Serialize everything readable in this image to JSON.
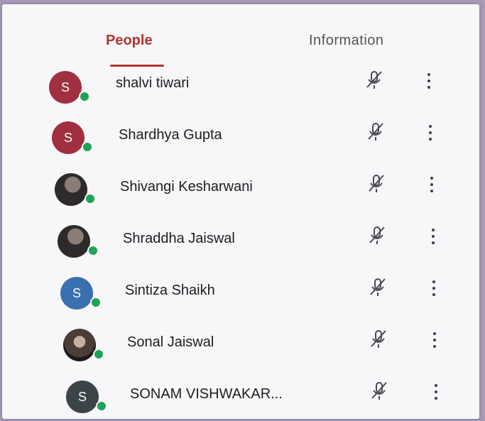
{
  "tabs": {
    "people": "People",
    "information": "Information"
  },
  "colors": {
    "accent": "#b3332f",
    "online": "#1fa357"
  },
  "icons": {
    "mic": "mic-off-icon",
    "more": "more-vert-icon"
  },
  "participants": [
    {
      "name": "shalvi tiwari",
      "initial": "S",
      "avatar_color": "#a0303f",
      "online": true,
      "muted": true
    },
    {
      "name": "Shardhya Gupta",
      "initial": "S",
      "avatar_color": "#a0303f",
      "online": true,
      "muted": true
    },
    {
      "name": "Shivangi Kesharwani",
      "initial": "",
      "avatar_color": "#2e2a2a",
      "online": true,
      "muted": true
    },
    {
      "name": "Shraddha Jaiswal",
      "initial": "",
      "avatar_color": "#2e2a2a",
      "online": true,
      "muted": true
    },
    {
      "name": "Sintiza Shaikh",
      "initial": "S",
      "avatar_color": "#3a6fb0",
      "online": true,
      "muted": true
    },
    {
      "name": "Sonal Jaiswal",
      "initial": "",
      "avatar_color": "#4a3c36",
      "online": true,
      "muted": true
    },
    {
      "name": "SONAM VISHWAKAR...",
      "initial": "S",
      "avatar_color": "#3b4448",
      "online": true,
      "muted": true
    }
  ]
}
